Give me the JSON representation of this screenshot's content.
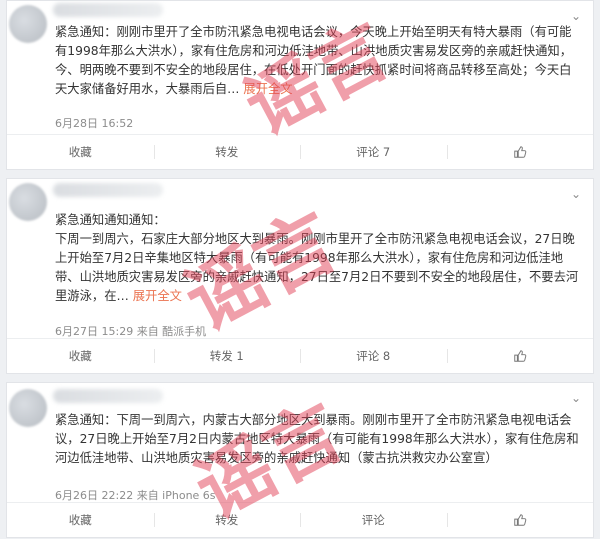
{
  "posts": [
    {
      "text_prefix": "紧急通知：刚刚市里开了全市防汛紧急电视电话会议，今天晚上开始至明天有特大暴雨（有可能有1998年那么大洪水），家有住危房和河边低洼地带、山洪地质灾害易发区旁的亲戚赶快通知，今、明两晚不要到不安全的地段居住，在低处开门面的赶快抓紧时间将商品转移至高处；今天白天大家储备好用水，大暴雨后自…",
      "expand": "展开全文",
      "meta": "6月28日 16:52",
      "actions": {
        "favorite": "收藏",
        "repost": "转发",
        "comment": "评论 7"
      }
    },
    {
      "header": "紧急通知通知通知：",
      "text_prefix": "下周一到周六，石家庄大部分地区大到暴雨。刚刚市里开了全市防汛紧急电视电话会议，27日晚上开始至7月2日辛集地区特大暴雨（有可能有1998年那么大洪水），家有住危房和河边低洼地带、山洪地质灾害易发区旁的亲戚赶快通知，27日至7月2日不要到不安全的地段居住，不要去河里游泳，在…",
      "expand": "展开全文",
      "meta": "6月27日 15:29 来自 酷派手机",
      "actions": {
        "favorite": "收藏",
        "repost": "转发 1",
        "comment": "评论 8"
      }
    },
    {
      "text_prefix": "紧急通知：下周一到周六，内蒙古大部分地区大到暴雨。刚刚市里开了全市防汛紧急电视电话会议，27日晚上开始至7月2日内蒙古地区特大暴雨（有可能有1998年那么大洪水），家有住危房和河边低洼地带、山洪地质灾害易发区旁的亲戚赶快通知（蒙古抗洪救灾办公室宣）",
      "meta": "6月26日 22:22 来自 iPhone 6s",
      "actions": {
        "favorite": "收藏",
        "repost": "转发",
        "comment": "评论"
      }
    }
  ],
  "watermark": "谣言",
  "colors": {
    "watermark": "#e24056",
    "link": "#eb7350"
  },
  "icons": {
    "chevron": "chevron-down-icon",
    "like": "thumbs-up-icon"
  }
}
